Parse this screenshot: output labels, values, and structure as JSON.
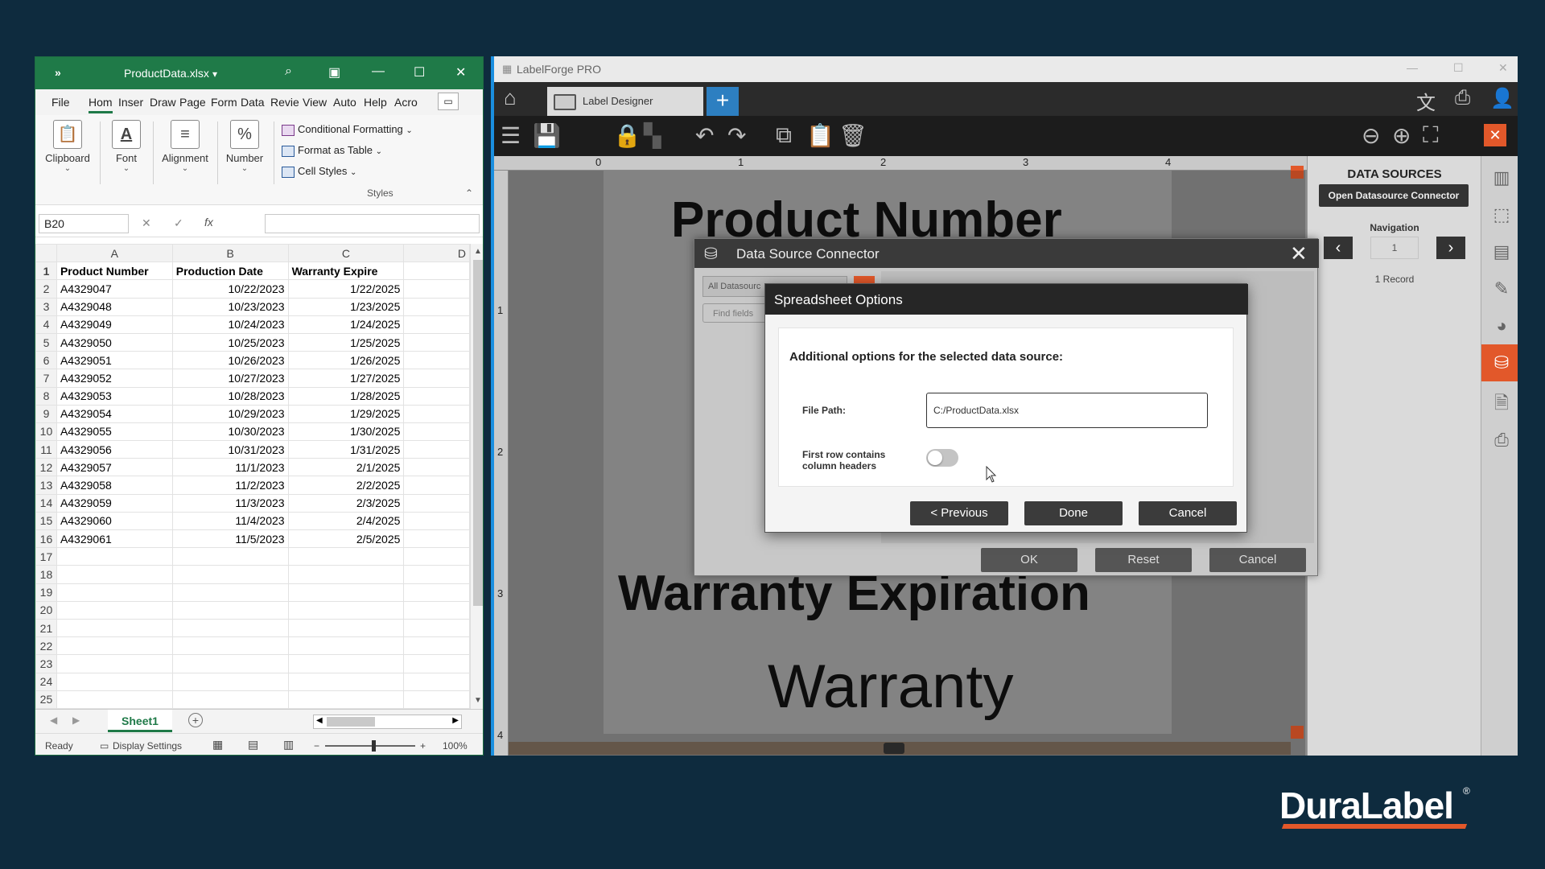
{
  "excel": {
    "quick_access": "»",
    "filename": "ProductData.xlsx",
    "tabs": [
      "File",
      "Hom",
      "Inser",
      "Draw",
      "Page",
      "Form",
      "Data",
      "Revie",
      "View",
      "Auto",
      "Help",
      "Acro"
    ],
    "ribbon": {
      "clipboard": "Clipboard",
      "font": "Font",
      "alignment": "Alignment",
      "number": "Number",
      "conditional_formatting": "Conditional Formatting",
      "format_as_table": "Format as Table",
      "cell_styles": "Cell Styles",
      "styles_group": "Styles"
    },
    "name_box": "B20",
    "fx": "fx",
    "columns": [
      "A",
      "B",
      "C",
      "D"
    ],
    "header_row": [
      "Product Number",
      "Production Date",
      "Warranty Expire"
    ],
    "rows": [
      [
        "A4329047",
        "10/22/2023",
        "1/22/2025"
      ],
      [
        "A4329048",
        "10/23/2023",
        "1/23/2025"
      ],
      [
        "A4329049",
        "10/24/2023",
        "1/24/2025"
      ],
      [
        "A4329050",
        "10/25/2023",
        "1/25/2025"
      ],
      [
        "A4329051",
        "10/26/2023",
        "1/26/2025"
      ],
      [
        "A4329052",
        "10/27/2023",
        "1/27/2025"
      ],
      [
        "A4329053",
        "10/28/2023",
        "1/28/2025"
      ],
      [
        "A4329054",
        "10/29/2023",
        "1/29/2025"
      ],
      [
        "A4329055",
        "10/30/2023",
        "1/30/2025"
      ],
      [
        "A4329056",
        "10/31/2023",
        "1/31/2025"
      ],
      [
        "A4329057",
        "11/1/2023",
        "2/1/2025"
      ],
      [
        "A4329058",
        "11/2/2023",
        "2/2/2025"
      ],
      [
        "A4329059",
        "11/3/2023",
        "2/3/2025"
      ],
      [
        "A4329060",
        "11/4/2023",
        "2/4/2025"
      ],
      [
        "A4329061",
        "11/5/2023",
        "2/5/2025"
      ]
    ],
    "row_numbers": [
      "1",
      "2",
      "3",
      "4",
      "5",
      "6",
      "7",
      "8",
      "9",
      "10",
      "11",
      "12",
      "13",
      "14",
      "15",
      "16",
      "17",
      "18",
      "19",
      "20",
      "21",
      "22",
      "23",
      "24",
      "25"
    ],
    "sheet_tab": "Sheet1",
    "status_ready": "Ready",
    "display_settings": "Display Settings",
    "zoom": "100%"
  },
  "labelforge": {
    "app_title": "LabelForge PRO",
    "tab_label": "Label Designer",
    "ruler_top": [
      "0",
      "1",
      "2",
      "3",
      "4"
    ],
    "ruler_left": [
      "1",
      "2",
      "3",
      "4"
    ],
    "canvas": {
      "product_number": "Product Number",
      "warranty_expiration": "Warranty Expiration",
      "warranty": "Warranty"
    },
    "data_sources": {
      "title": "DATA SOURCES",
      "open_button": "Open Datasource Connector",
      "navigation": "Navigation",
      "record_value": "1",
      "record_count": "1 Record"
    },
    "connector": {
      "title": "Data Source Connector",
      "filter_value": "All Datasourc",
      "find_placeholder": "Find fields",
      "ok": "OK",
      "reset": "Reset",
      "cancel": "Cancel"
    },
    "spreadsheet_options": {
      "title": "Spreadsheet Options",
      "heading": "Additional options for the selected data source:",
      "file_path_label": "File Path:",
      "file_path_value": "C:/ProductData.xlsx",
      "first_row_label_1": "First row contains",
      "first_row_label_2": "column headers",
      "first_row_enabled": false,
      "previous": "< Previous",
      "done": "Done",
      "cancel": "Cancel"
    }
  },
  "brand": {
    "name": "DuraLabel",
    "mark": "®",
    "accent_color": "#e2582a"
  }
}
